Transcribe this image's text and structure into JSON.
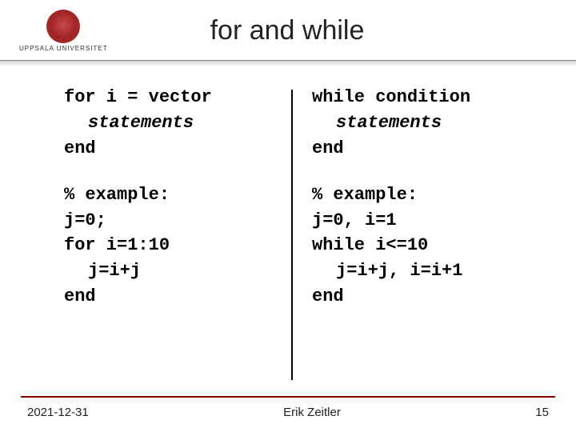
{
  "header": {
    "university": "UPPSALA UNIVERSITET",
    "title": "for and while"
  },
  "left": {
    "syntax_line1": "for i = vector",
    "syntax_line2": "statements",
    "syntax_line3": "end",
    "ex_l1": "% example:",
    "ex_l2": "j=0;",
    "ex_l3": "for i=1:10",
    "ex_l4": "j=i+j",
    "ex_l5": "end"
  },
  "right": {
    "syntax_line1": "while condition",
    "syntax_line2": "statements",
    "syntax_line3": "end",
    "ex_l1": "% example:",
    "ex_l2": "j=0, i=1",
    "ex_l3": "while i<=10",
    "ex_l4": "j=i+j, i=i+1",
    "ex_l5": "end"
  },
  "footer": {
    "date": "2021-12-31",
    "author": "Erik Zeitler",
    "page": "15"
  }
}
